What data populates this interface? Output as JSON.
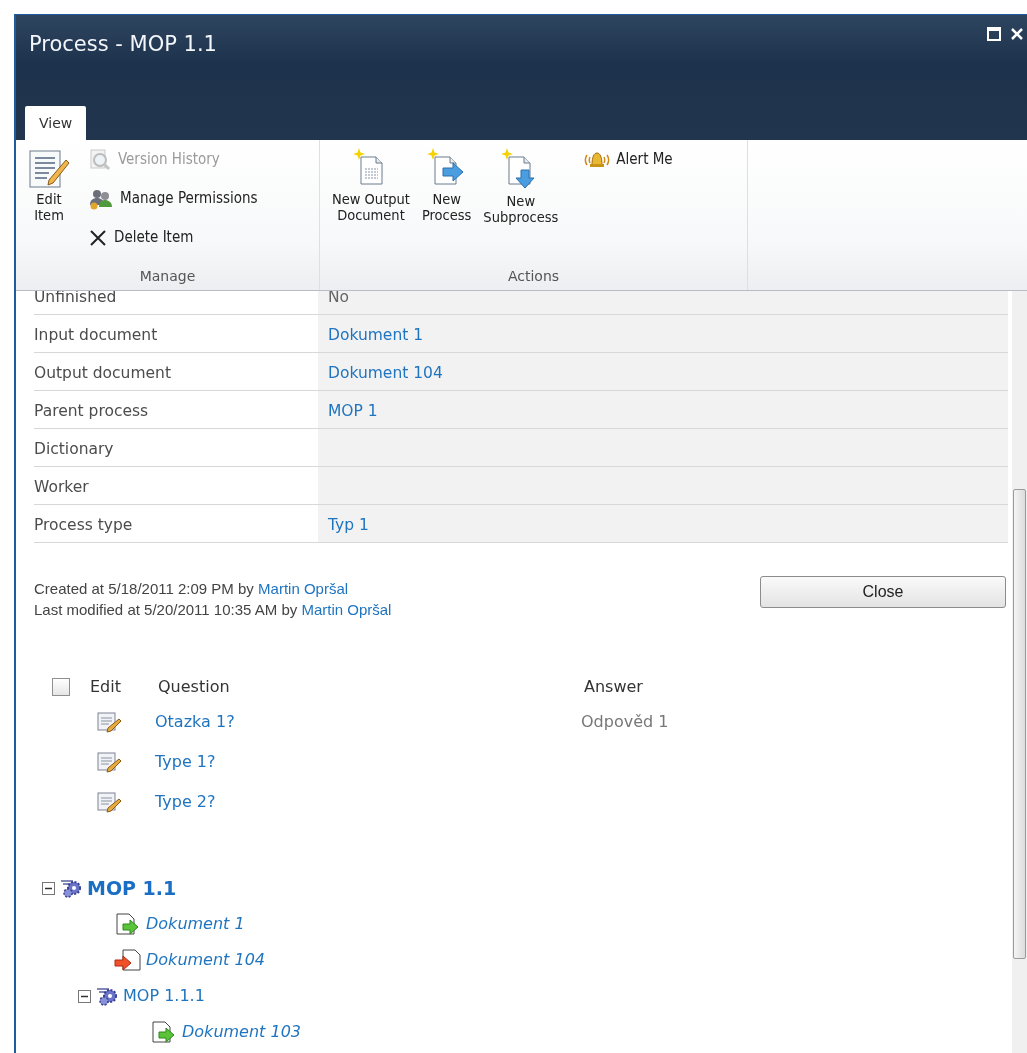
{
  "window": {
    "title": "Process - MOP 1.1"
  },
  "tabs": [
    {
      "label": "View",
      "selected": true
    }
  ],
  "ribbon": {
    "groups": [
      {
        "title": "Manage",
        "large": [
          {
            "label": "Edit\nItem",
            "kind": "edit"
          }
        ],
        "small": [
          {
            "label": "Version History",
            "kind": "history",
            "disabled": true
          },
          {
            "label": "Manage Permissions",
            "kind": "permissions",
            "disabled": false
          },
          {
            "label": "Delete Item",
            "kind": "delete",
            "disabled": false
          }
        ]
      },
      {
        "title": "Actions",
        "large": [
          {
            "label": "New Output\nDocument",
            "kind": "new-doc"
          },
          {
            "label": "New\nProcess",
            "kind": "new-process"
          },
          {
            "label": "New\nSubprocess",
            "kind": "new-subprocess"
          }
        ],
        "small": [
          {
            "label": "Alert Me",
            "kind": "alert",
            "disabled": false
          }
        ]
      }
    ]
  },
  "fields": [
    {
      "label": "Unfinished",
      "value": "No",
      "link": false
    },
    {
      "label": "Input document",
      "value": "Dokument 1",
      "link": true
    },
    {
      "label": "Output document",
      "value": "Dokument 104",
      "link": true
    },
    {
      "label": "Parent process",
      "value": "MOP 1",
      "link": true
    },
    {
      "label": "Dictionary"
    },
    {
      "label": "Worker"
    },
    {
      "label": "Process type",
      "value": "Typ 1",
      "link": true
    }
  ],
  "meta": [
    {
      "text": "Created at 5/18/2011 2:09 PM by",
      "user": "Martin Opršal"
    },
    {
      "text": "Last modified at 5/20/2011 10:35 AM by",
      "user": "Martin Opršal"
    }
  ],
  "close_button": "Close",
  "questions": {
    "select_all": {
      "checked": false
    },
    "columns": [
      "Edit",
      "Question",
      "Answer"
    ],
    "rows": [
      {
        "question": "Otazka 1?",
        "answer": "Odpověd 1"
      },
      {
        "question": "Type 1?"
      },
      {
        "question": "Type 2?"
      }
    ]
  },
  "tree": [
    {
      "label": "MOP 1.1",
      "kind": "process",
      "expanded": true,
      "children": [
        {
          "label": "Dokument 1",
          "kind": "input"
        },
        {
          "label": "Dokument 104",
          "kind": "output"
        },
        {
          "label": "MOP 1.1.1",
          "kind": "process",
          "expanded": true,
          "children": [
            {
              "label": "Dokument 103",
              "kind": "input"
            }
          ]
        }
      ]
    }
  ]
}
